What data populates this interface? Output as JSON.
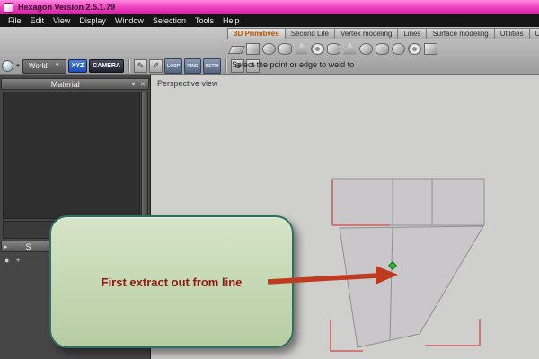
{
  "window": {
    "title": "Hexagon Version 2.5.1.79"
  },
  "menu_bar": {
    "items": [
      "File",
      "Edit",
      "View",
      "Display",
      "Window",
      "Selection",
      "Tools",
      "Help"
    ]
  },
  "tab_bar": {
    "tabs": [
      {
        "label": "3D Primitives",
        "active": true
      },
      {
        "label": "Second Life",
        "active": false
      },
      {
        "label": "Vertex modeling",
        "active": false
      },
      {
        "label": "Lines",
        "active": false
      },
      {
        "label": "Surface modeling",
        "active": false
      },
      {
        "label": "Utilities",
        "active": false
      },
      {
        "label": "UV",
        "active": false
      }
    ]
  },
  "primitives_toolbar": {
    "icons": [
      {
        "name": "plane-icon",
        "shape": "plane"
      },
      {
        "name": "cube-icon",
        "shape": "cube"
      },
      {
        "name": "sphere-icon",
        "shape": "sphere"
      },
      {
        "name": "cylinder-icon",
        "shape": "cylinder"
      },
      {
        "name": "cone-icon",
        "shape": "cone"
      },
      {
        "name": "torus-icon",
        "shape": "torus"
      },
      {
        "name": "tube-icon",
        "shape": "cylinder"
      },
      {
        "name": "pyramid-icon",
        "shape": "cone"
      },
      {
        "name": "geodesic-sphere-icon",
        "shape": "sphere"
      },
      {
        "name": "capsule-icon",
        "shape": "cylinder"
      },
      {
        "name": "disc-icon",
        "shape": "sphere"
      },
      {
        "name": "ring-icon",
        "shape": "torus"
      },
      {
        "name": "rounded-cube-icon",
        "shape": "cube"
      }
    ]
  },
  "control_bar": {
    "world_selector": {
      "value": "World"
    },
    "xyz_button": "XYZ",
    "camera_button": "CAMERA",
    "tool_icons_left": [
      {
        "name": "pencil-tool-icon",
        "glyph": "✎"
      },
      {
        "name": "pen-tool-icon",
        "glyph": "✐"
      }
    ],
    "selection_buttons": [
      "LOOP",
      "RING",
      "BETW"
    ],
    "tool_icons_right": [
      {
        "name": "weld-tool-icon",
        "glyph": "⊕"
      },
      {
        "name": "target-weld-tool-icon",
        "glyph": "⌖"
      }
    ],
    "status_text": "Select the point or edge to weld to"
  },
  "left_panels": {
    "material_panel": {
      "title": "Material",
      "collapse_icon": "▾",
      "close_icon": "✕"
    },
    "scene_panel": {
      "title": "S",
      "expand_icon": "▸",
      "tools": [
        {
          "name": "visibility-icon",
          "glyph": "●"
        },
        {
          "name": "add-icon",
          "glyph": "+"
        }
      ]
    }
  },
  "viewport": {
    "label": "Perspective view"
  },
  "callout": {
    "text": "First extract out from line"
  },
  "colors": {
    "titlebar": "#ea3fbc",
    "active_tab_text": "#b45400",
    "callout_bg": "#c6d8b5",
    "callout_border": "#2f6e63",
    "arrow": "#bf3a1e",
    "selected_edge": "#cf5f5f",
    "vertex_green": "#2eb82e",
    "viewport_bg": "#cfcfce"
  }
}
